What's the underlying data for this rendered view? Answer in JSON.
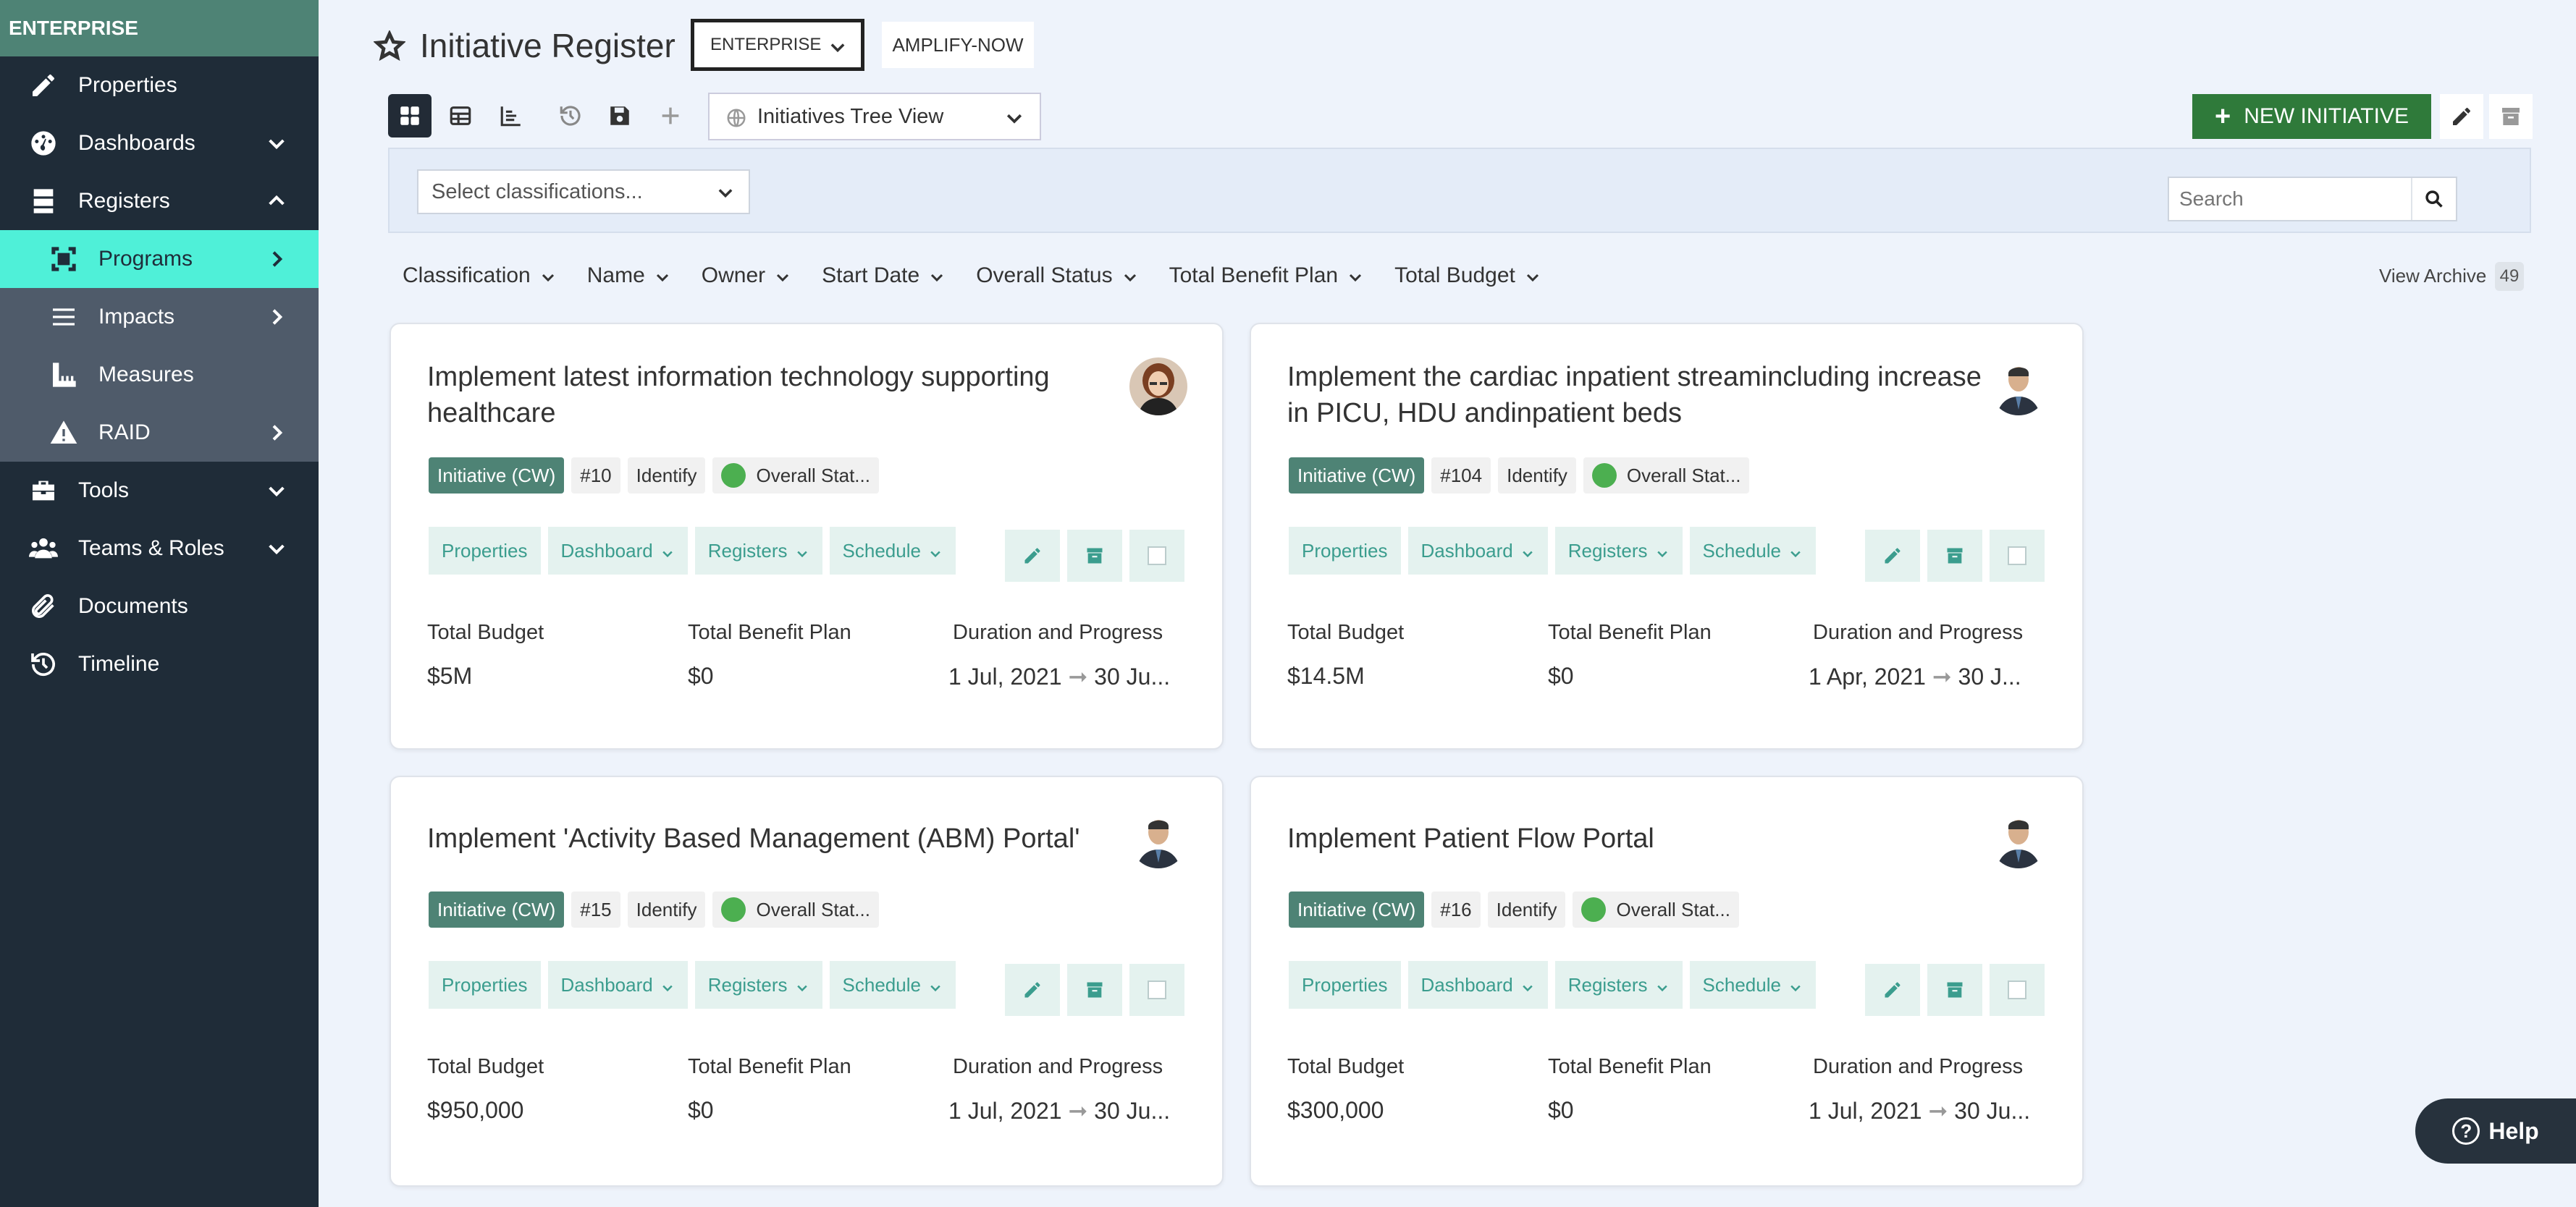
{
  "sidebar": {
    "header": "ENTERPRISE",
    "items": [
      {
        "label": "Properties",
        "icon": "pencil-icon"
      },
      {
        "label": "Dashboards",
        "icon": "dashboard-icon"
      },
      {
        "label": "Registers",
        "icon": "registers-icon"
      },
      {
        "label": "Programs",
        "icon": "programs-icon"
      },
      {
        "label": "Impacts",
        "icon": "impacts-icon"
      },
      {
        "label": "Measures",
        "icon": "measures-icon"
      },
      {
        "label": "RAID",
        "icon": "warning-icon"
      },
      {
        "label": "Tools",
        "icon": "toolbox-icon"
      },
      {
        "label": "Teams & Roles",
        "icon": "users-icon"
      },
      {
        "label": "Documents",
        "icon": "paperclip-icon"
      },
      {
        "label": "Timeline",
        "icon": "history-icon"
      }
    ]
  },
  "header": {
    "title": "Initiative Register",
    "enterprise_select": "ENTERPRISE",
    "amplify_button": "AMPLIFY-NOW"
  },
  "toolbar": {
    "view_select": "Initiatives Tree View",
    "new_button": "NEW INITIATIVE"
  },
  "filters": {
    "classification_placeholder": "Select classifications...",
    "search_placeholder": "Search"
  },
  "sortbar": {
    "items": [
      "Classification",
      "Name",
      "Owner",
      "Start Date",
      "Overall Status",
      "Total Benefit Plan",
      "Total Budget"
    ],
    "view_archive": "View Archive",
    "archive_count": "49"
  },
  "card_labels": {
    "properties": "Properties",
    "dashboard": "Dashboard",
    "registers": "Registers",
    "schedule": "Schedule",
    "total_budget": "Total Budget",
    "total_benefit_plan": "Total Benefit Plan",
    "duration_progress": "Duration and Progress",
    "arrow": "➞"
  },
  "cards": [
    {
      "title": "Implement latest information technology supporting healthcare",
      "type": "Initiative (CW)",
      "number": "#10",
      "stage": "Identify",
      "status": "Overall Stat...",
      "budget": "$5M",
      "benefit": "$0",
      "start": "1 Jul, 2021",
      "end": "30 Ju..."
    },
    {
      "title": "Implement the cardiac inpatient streamincluding increase in PICU, HDU andinpatient beds",
      "type": "Initiative (CW)",
      "number": "#104",
      "stage": "Identify",
      "status": "Overall Stat...",
      "budget": "$14.5M",
      "benefit": "$0",
      "start": "1 Apr, 2021",
      "end": "30 J..."
    },
    {
      "title": "Implement 'Activity Based Management (ABM) Portal'",
      "type": "Initiative (CW)",
      "number": "#15",
      "stage": "Identify",
      "status": "Overall Stat...",
      "budget": "$950,000",
      "benefit": "$0",
      "start": "1 Jul, 2021",
      "end": "30 Ju..."
    },
    {
      "title": "Implement Patient Flow Portal",
      "type": "Initiative (CW)",
      "number": "#16",
      "stage": "Identify",
      "status": "Overall Stat...",
      "budget": "$300,000",
      "benefit": "$0",
      "start": "1 Jul, 2021",
      "end": "30 Ju..."
    }
  ],
  "help": {
    "label": "Help"
  },
  "colors": {
    "sidebar_bg": "#3d4a59",
    "sidebar_header": "#4e8375",
    "active_item": "#4ff0d8",
    "primary_button": "#2f7a3a",
    "tag_green": "#4e8375",
    "status_green": "#4caf50"
  }
}
